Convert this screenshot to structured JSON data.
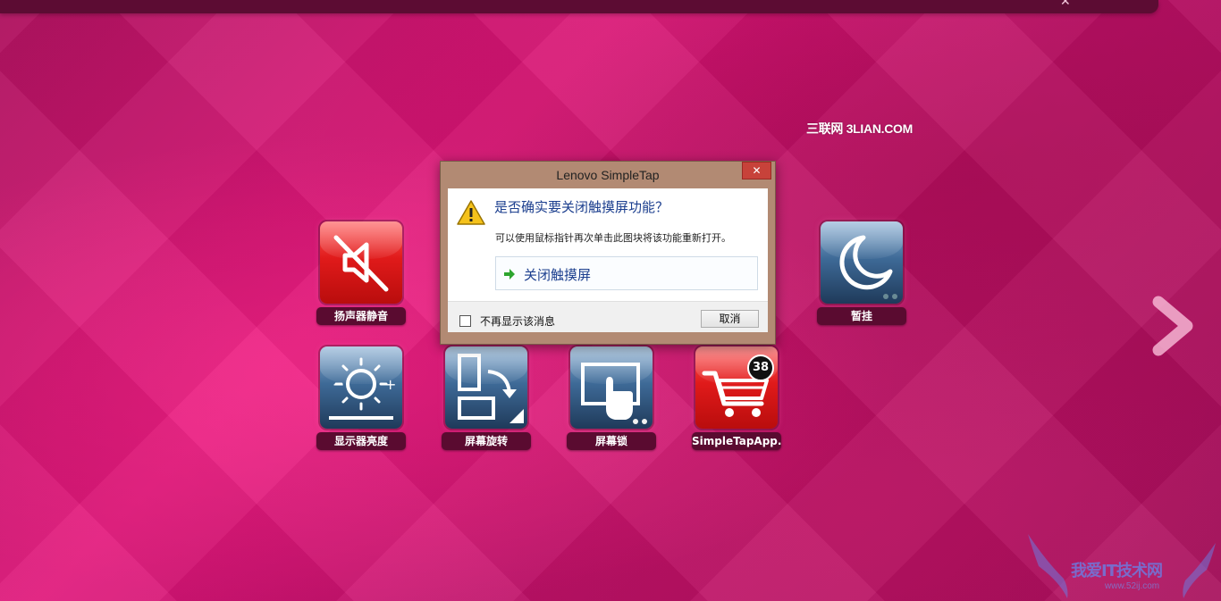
{
  "top_bar": {
    "close_glyph": "✕"
  },
  "watermark_top": "三联网 3LIAN.COM",
  "tiles": [
    {
      "label": "扬声器静音",
      "icon": "speaker-mute-icon",
      "style": "red"
    },
    {
      "label": "暂挂",
      "icon": "moon-icon",
      "style": "blue"
    },
    {
      "label": "显示器亮度",
      "icon": "brightness-icon",
      "style": "blue"
    },
    {
      "label": "屏幕旋转",
      "icon": "rotate-screen-icon",
      "style": "blue"
    },
    {
      "label": "屏幕锁",
      "icon": "touch-lock-icon",
      "style": "blue"
    },
    {
      "label": "SimpleTapApp...",
      "icon": "shopping-cart-icon",
      "style": "red",
      "badge": "38"
    }
  ],
  "dialog": {
    "title": "Lenovo SimpleTap",
    "close_glyph": "✕",
    "heading": "是否确实要关闭触摸屏功能？",
    "description": "可以使用鼠标指针再次单击此图块将该功能重新打开。",
    "command_label": "关闭触摸屏",
    "checkbox_label": "不再显示该消息",
    "checkbox_checked": false,
    "cancel_label": "取消"
  },
  "watermark_bottom": {
    "text": "我爱IT技术网",
    "url": "www.52ij.com"
  },
  "colors": {
    "background": "#d0146f",
    "label_bg": "#5a0b30",
    "heading": "#1b3e8e"
  }
}
